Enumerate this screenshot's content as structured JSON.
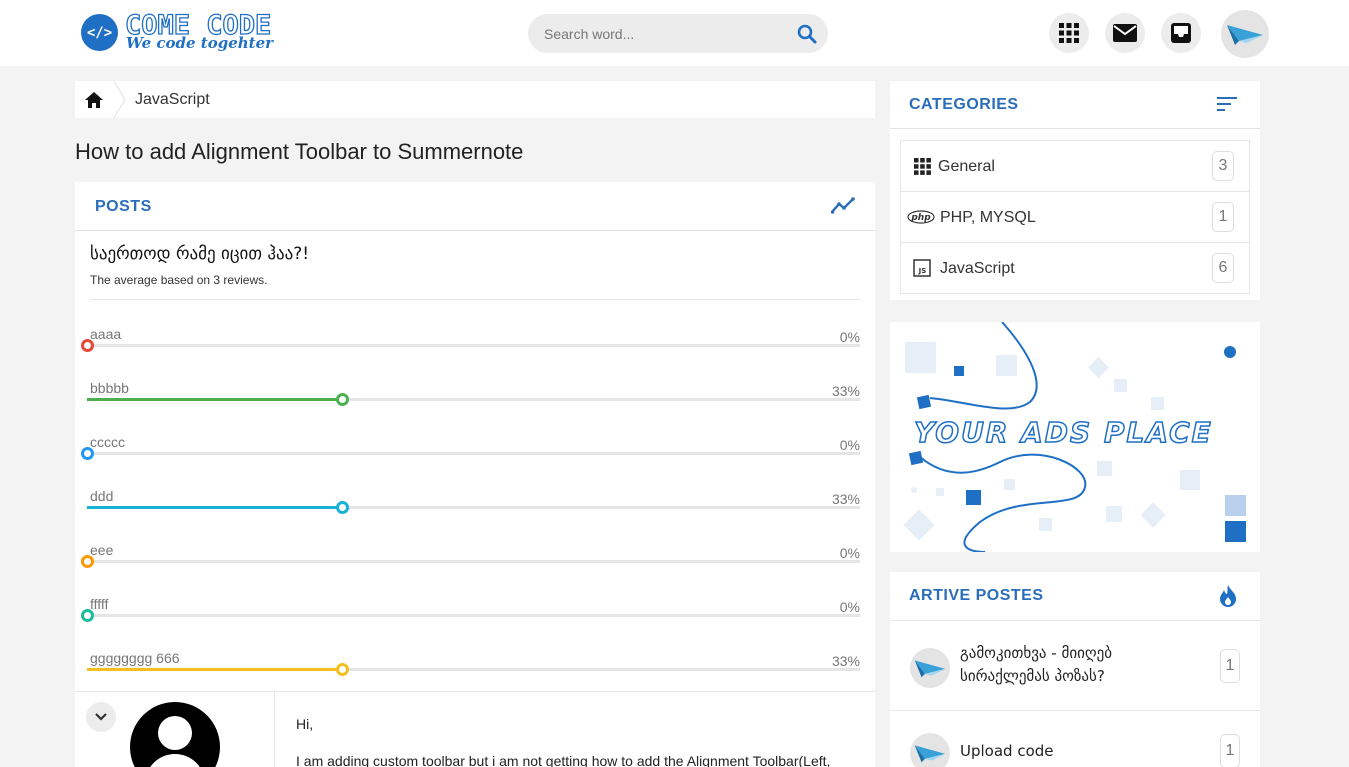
{
  "header": {
    "logo_title": "COME CODE",
    "logo_tagline": "We code togehter",
    "search_placeholder": "Search word..."
  },
  "breadcrumb": {
    "items": [
      "JavaScript"
    ]
  },
  "page_title": "How to add Alignment Toolbar to Summernote",
  "posts": {
    "heading": "POSTS",
    "poll": {
      "question": "საერთოდ რამე იცით ჰაა?!",
      "subtitle": "The average based on 3 reviews.",
      "options": [
        {
          "label": "aaaa",
          "percent": "0%",
          "value": 0,
          "color": "#e9453a"
        },
        {
          "label": "bbbbb",
          "percent": "33%",
          "value": 33,
          "color": "#4caf50"
        },
        {
          "label": "ccccc",
          "percent": "0%",
          "value": 0,
          "color": "#2196f3"
        },
        {
          "label": "ddd",
          "percent": "33%",
          "value": 33,
          "color": "#17b2d2"
        },
        {
          "label": "eee",
          "percent": "0%",
          "value": 0,
          "color": "#ff9800"
        },
        {
          "label": "fffff",
          "percent": "0%",
          "value": 0,
          "color": "#1abc9c"
        },
        {
          "label": "gggggggg 666",
          "percent": "33%",
          "value": 33,
          "color": "#f4c01e"
        }
      ]
    },
    "post": {
      "greeting": "Hi,",
      "body": "I am adding custom toolbar but i am not getting how to add the Alignment Toolbar(Left,"
    }
  },
  "sidebar": {
    "categories": {
      "heading": "CATEGORIES",
      "items": [
        {
          "label": "General",
          "count": "3",
          "icon": "grid-icon"
        },
        {
          "label": "PHP, MYSQL",
          "count": "1",
          "icon": "php-icon"
        },
        {
          "label": "JavaScript",
          "count": "6",
          "icon": "js-icon"
        }
      ]
    },
    "ads": {
      "text": "YOUR ADS PLACE"
    },
    "active_posts": {
      "heading": "ARTIVE POSTES",
      "items": [
        {
          "title": "გამოკითხვა - მიიღებ სირაქლემას პოზას?",
          "count": "1"
        },
        {
          "title": "Upload code",
          "count": "1"
        }
      ]
    }
  },
  "colors": {
    "accent": "#2a6ebb",
    "brand": "#1f6fc4"
  }
}
